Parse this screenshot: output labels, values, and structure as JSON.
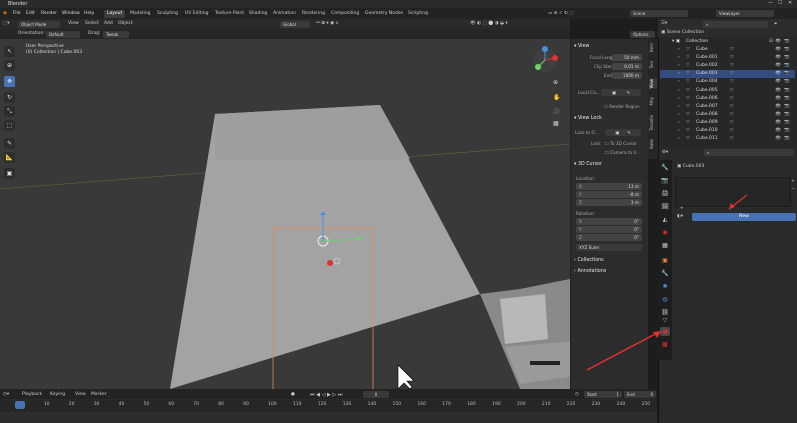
{
  "app": {
    "title": "Blender"
  },
  "menu": {
    "items": [
      "File",
      "Edit",
      "Render",
      "Window",
      "Help"
    ],
    "workspaces": [
      "Layout",
      "Modeling",
      "Sculpting",
      "UV Editing",
      "Texture Paint",
      "Shading",
      "Animation",
      "Rendering",
      "Compositing",
      "Geometry Nodes",
      "Scripting"
    ],
    "active_workspace": "Layout",
    "scene": "Scene",
    "view_layer": "ViewLayer"
  },
  "viewport_header": {
    "mode": "Object Mode",
    "menus": [
      "View",
      "Select",
      "Add",
      "Object"
    ],
    "transform": "Global"
  },
  "tool_header": {
    "orientation_label": "Orientation:",
    "orientation_value": "Default",
    "drag_label": "Drag:",
    "drag_value": "Tweak",
    "options": "Options"
  },
  "viewport": {
    "overlay_line1": "User Perspective",
    "overlay_line2": "(0) Collection | Cube.003"
  },
  "npanel": {
    "tabs": [
      "Item",
      "Tool",
      "View",
      "Mtly",
      "Tesselle",
      "Bake"
    ],
    "view_section": "View",
    "focal_length_label": "Focal Length",
    "focal_length": "50 mm",
    "clip_start_label": "Clip Start",
    "clip_start": "0.01 m",
    "end_label": "End",
    "end": "1000 m",
    "local_camera_label": "Local Ca...",
    "render_region": "Render Region",
    "view_lock_section": "View Lock",
    "lock_to_object_label": "Lock to O...",
    "lock_label": "Lock",
    "to_3d_cursor": "To 3D Cursor",
    "camera_to_view": "Camera to V...",
    "cursor_section": "3D Cursor",
    "location_label": "Location:",
    "loc_x": "13 m",
    "loc_y": "-8 m",
    "loc_z": "3 m",
    "rotation_label": "Rotation:",
    "rot_x": "0°",
    "rot_y": "0°",
    "rot_z": "0°",
    "rotation_mode": "XYZ Euler",
    "collections": "Collections",
    "annotations": "Annotations"
  },
  "outliner": {
    "search_placeholder": "",
    "scene_collection": "Scene Collection",
    "collection": "Collection",
    "objects": [
      {
        "name": "Cube",
        "selected": false
      },
      {
        "name": "Cube.001",
        "selected": false
      },
      {
        "name": "Cube.002",
        "selected": false
      },
      {
        "name": "Cube.003",
        "selected": true
      },
      {
        "name": "Cube.004",
        "selected": false
      },
      {
        "name": "Cube.005",
        "selected": false
      },
      {
        "name": "Cube.006",
        "selected": false
      },
      {
        "name": "Cube.007",
        "selected": false
      },
      {
        "name": "Cube.008",
        "selected": false
      },
      {
        "name": "Cube.009",
        "selected": false
      },
      {
        "name": "Cube.010",
        "selected": false
      },
      {
        "name": "Cube.011",
        "selected": false
      }
    ]
  },
  "properties": {
    "object_name": "Cube.003",
    "new_button": "New"
  },
  "timeline": {
    "menus": [
      "Playback",
      "Keying",
      "View",
      "Marker"
    ],
    "current_frame": "0",
    "start_label": "Start",
    "start": "1",
    "end_label": "End",
    "end": "0",
    "ticks": [
      "0",
      "10",
      "20",
      "30",
      "40",
      "50",
      "60",
      "70",
      "80",
      "90",
      "100",
      "110",
      "120",
      "130",
      "140",
      "150",
      "160",
      "170",
      "180",
      "190",
      "200",
      "210",
      "220",
      "230",
      "240",
      "250"
    ]
  },
  "colors": {
    "accent": "#4772b3",
    "selected_row": "#334d80",
    "mesh_green": "#6bd46b",
    "annotation_red": "#e03030"
  }
}
